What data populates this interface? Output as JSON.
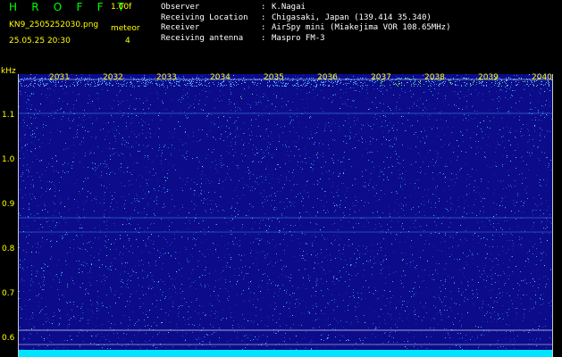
{
  "header": {
    "app_title": "H R O F F T",
    "version": "1.00f",
    "filename": "KN9_2505252030.png",
    "mode_label": "meteor",
    "datetime": "25.05.25 20:30",
    "mode_value": "4"
  },
  "info": [
    {
      "label": "Observer",
      "sep": ":",
      "value": "K.Nagai"
    },
    {
      "label": "Receiving Location",
      "sep": ":",
      "value": "Chigasaki, Japan (139.414 35.340)"
    },
    {
      "label": "Receiver",
      "sep": ":",
      "value": "AirSpy mini (Miakejima VOR 108.65MHz)"
    },
    {
      "label": "Receiving antenna",
      "sep": ":",
      "value": "Maspro FM-3"
    }
  ],
  "spectrogram": {
    "y_unit": "kHz",
    "y_ticks": [
      "1.1",
      "1.0",
      "0.9",
      "0.8",
      "0.7",
      "0.6"
    ],
    "x_ticks": [
      "2031",
      "2032",
      "2033",
      "2034",
      "2035",
      "2036",
      "2037",
      "2038",
      "2039",
      "2040"
    ],
    "colors": {
      "background": "#0c0c8a",
      "label": "#ffff00",
      "title": "#00ff00",
      "noise_floor": "#00e5ff",
      "line": "#c8c8c8"
    }
  }
}
